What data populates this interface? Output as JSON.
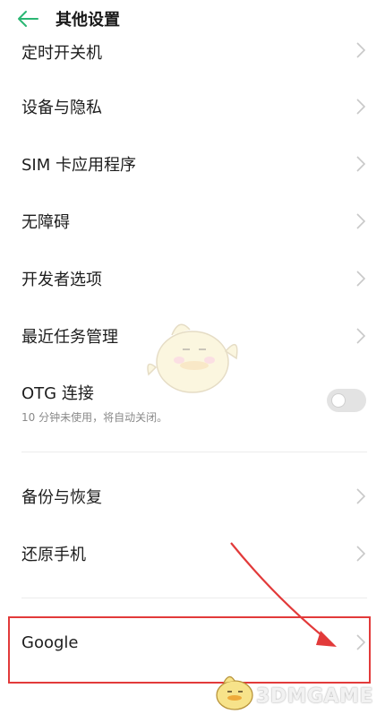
{
  "header": {
    "title": "其他设置"
  },
  "items": [
    {
      "label": "定时开关机"
    },
    {
      "label": "设备与隐私"
    },
    {
      "label": "SIM 卡应用程序"
    },
    {
      "label": "无障碍"
    },
    {
      "label": "开发者选项"
    },
    {
      "label": "最近任务管理"
    }
  ],
  "otg": {
    "label": "OTG 连接",
    "sublabel": "10 分钟未使用，将自动关闭。",
    "enabled": false
  },
  "group2": [
    {
      "label": "备份与恢复"
    },
    {
      "label": "还原手机"
    }
  ],
  "google": {
    "label": "Google"
  },
  "colors": {
    "accent": "#2bb673",
    "highlight": "#e23a3a",
    "annotation_arrow": "#e23a3a"
  },
  "watermark": {
    "text": "3DMGAME"
  }
}
